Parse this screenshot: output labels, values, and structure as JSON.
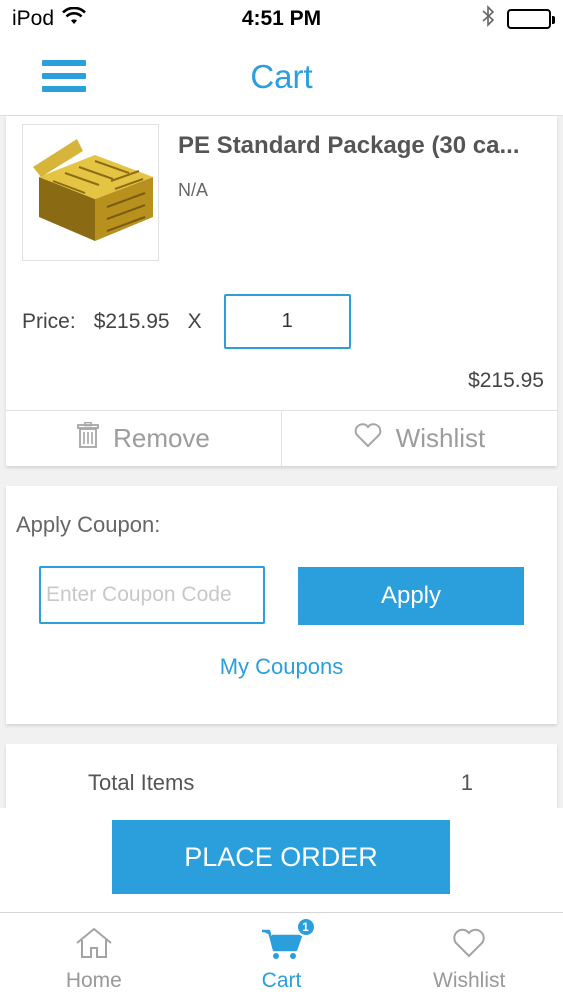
{
  "status_bar": {
    "carrier": "iPod",
    "time": "4:51 PM"
  },
  "header": {
    "title": "Cart"
  },
  "cart_item": {
    "name": "PE Standard Package (30 ca...",
    "variant": "N/A",
    "price_label": "Price:",
    "price": "$215.95",
    "multiply": "X",
    "quantity": "1",
    "subtotal": "$215.95",
    "remove_label": "Remove",
    "wishlist_label": "Wishlist"
  },
  "coupon": {
    "title": "Apply Coupon:",
    "placeholder": "Enter Coupon Code",
    "apply_label": "Apply",
    "my_coupons_label": "My Coupons"
  },
  "summary": {
    "total_items_label": "Total Items",
    "total_items_value": "1"
  },
  "place_order_label": "PLACE ORDER",
  "tabs": [
    {
      "label": "Home",
      "icon": "home-icon"
    },
    {
      "label": "Cart",
      "icon": "cart-icon",
      "badge": "1"
    },
    {
      "label": "Wishlist",
      "icon": "heart-icon"
    }
  ],
  "colors": {
    "accent": "#2b9fdc",
    "muted": "#9c9c9c",
    "background": "#f1f1f1"
  }
}
